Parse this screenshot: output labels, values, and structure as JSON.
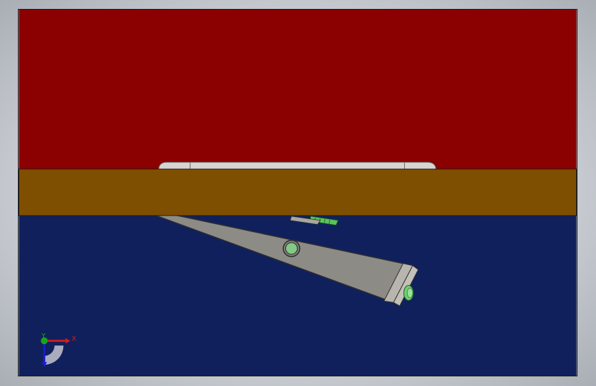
{
  "scene": {
    "colors": {
      "top_block": "#8b0000",
      "middle_bar": "#7e4f00",
      "bottom_block": "#10205c",
      "part_body": "#8c8a86",
      "part_edge": "#3a3a3a",
      "accent_green": "#6fcf6f",
      "hinge_plate": "#d8d4cf"
    }
  },
  "triad": {
    "x_label": "X",
    "y_label": "Y",
    "colors": {
      "x_axis": "#d21f1f",
      "y_axis": "#17a51c",
      "z_axis": "#1a1ad2"
    }
  }
}
